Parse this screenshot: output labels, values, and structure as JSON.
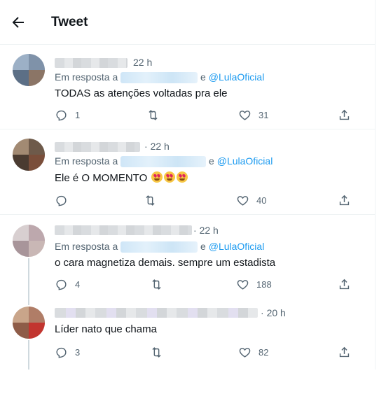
{
  "header": {
    "title": "Tweet"
  },
  "tweets": [
    {
      "time": "22 h",
      "reply_prefix": "Em resposta a",
      "reply_mid": "e",
      "mention": "@LulaOficial",
      "text": "TODAS as atenções voltadas pra ele",
      "replies": "1",
      "retweets": "",
      "likes": "31",
      "emojis": []
    },
    {
      "time": "22 h",
      "reply_prefix": "Em resposta a",
      "reply_mid": "e",
      "mention": "@LulaOficial",
      "text": "Ele é O MOMENTO",
      "replies": "",
      "retweets": "",
      "likes": "40",
      "emojis": [
        "star-struck-emoji",
        "star-struck-emoji",
        "star-struck-emoji"
      ]
    },
    {
      "time": "22 h",
      "reply_prefix": "Em resposta a",
      "reply_mid": "e",
      "mention": "@LulaOficial",
      "text": "o cara magnetiza demais. sempre um estadista",
      "replies": "4",
      "retweets": "",
      "likes": "188",
      "emojis": []
    },
    {
      "time": "20 h",
      "text": "Líder nato que chama",
      "replies": "3",
      "retweets": "",
      "likes": "82",
      "emojis": []
    }
  ],
  "icons": {
    "back": "arrow-left-icon",
    "reply": "reply-icon",
    "retweet": "retweet-icon",
    "like": "heart-icon",
    "share": "share-icon"
  },
  "colors": {
    "mention": "#1d9bf0",
    "secondary_text": "#536471",
    "divider": "#eff3f4"
  }
}
